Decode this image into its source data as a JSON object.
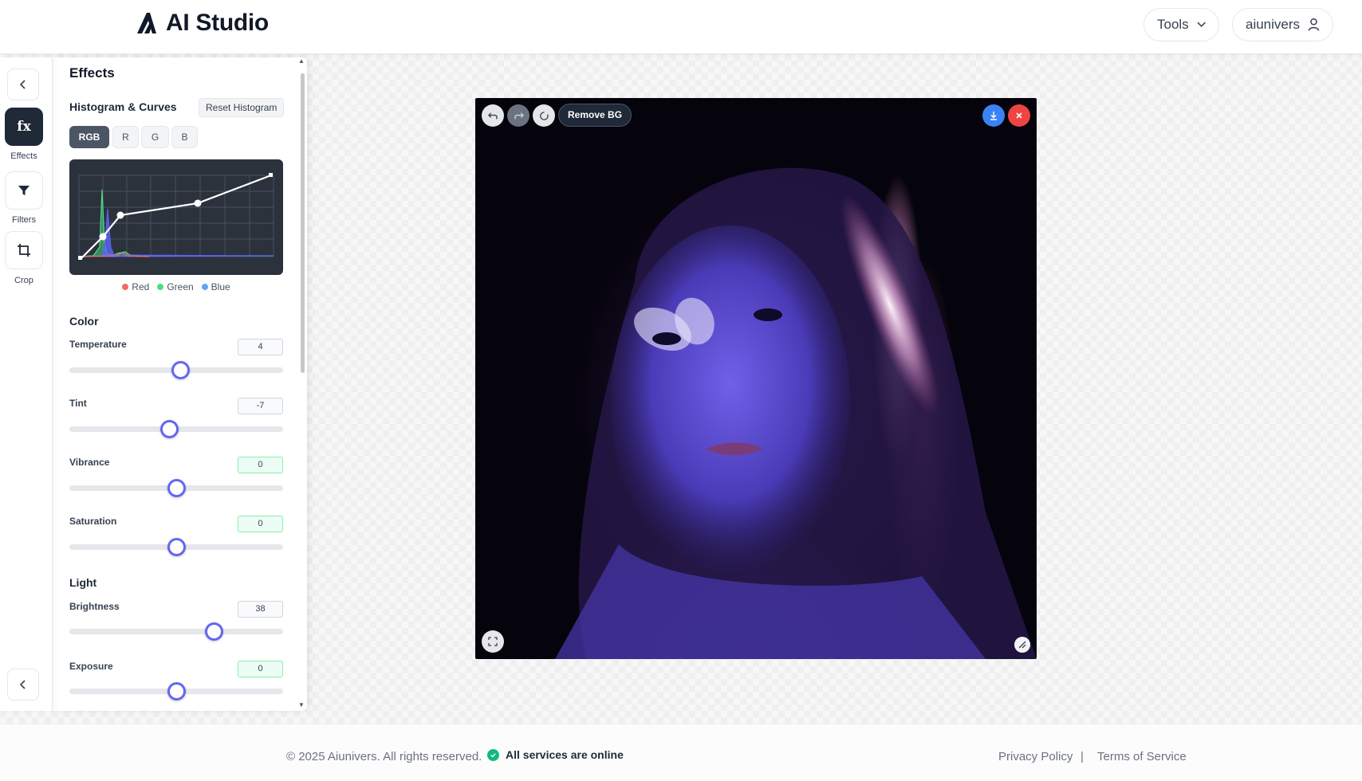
{
  "header": {
    "app_title": "AI Studio",
    "tools_label": "Tools",
    "user_label": "aiunivers"
  },
  "rail": {
    "tools": [
      {
        "label": "Effects",
        "glyph": "fx",
        "active": true
      },
      {
        "label": "Filters",
        "icon": "funnel-icon",
        "active": false
      },
      {
        "label": "Crop",
        "icon": "crop-icon",
        "active": false
      }
    ]
  },
  "panel": {
    "title": "Effects",
    "histogram": {
      "title": "Histogram & Curves",
      "reset_label": "Reset Histogram",
      "channels": [
        "RGB",
        "R",
        "G",
        "B"
      ],
      "active_channel": "RGB",
      "legend": [
        {
          "label": "Red",
          "color": "#ef6b6b"
        },
        {
          "label": "Green",
          "color": "#4ade80"
        },
        {
          "label": "Blue",
          "color": "#60a5fa"
        }
      ]
    },
    "color_group": {
      "title": "Color",
      "sliders": [
        {
          "label": "Temperature",
          "value": "4",
          "position": 0.52
        },
        {
          "label": "Tint",
          "value": "-7",
          "position": 0.465
        },
        {
          "label": "Vibrance",
          "value": "0",
          "position": 0.5
        },
        {
          "label": "Saturation",
          "value": "0",
          "position": 0.5
        }
      ]
    },
    "light_group": {
      "title": "Light",
      "sliders": [
        {
          "label": "Brightness",
          "value": "38",
          "position": 0.675
        },
        {
          "label": "Exposure",
          "value": "0",
          "position": 0.5
        }
      ]
    }
  },
  "image": {
    "remove_bg_label": "Remove BG"
  },
  "footer": {
    "copyright": "© 2025 Aiunivers. All rights reserved.",
    "status": "All services are online",
    "privacy": "Privacy Policy",
    "separator": "|",
    "terms": "Terms of Service"
  }
}
